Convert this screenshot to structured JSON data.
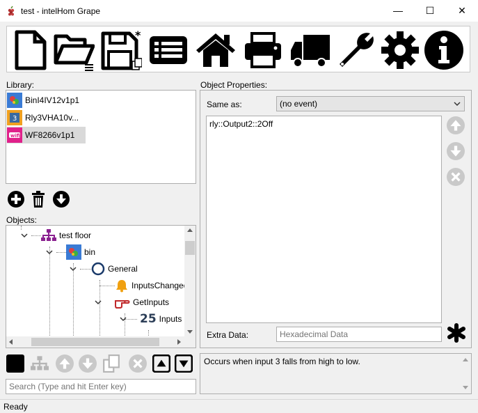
{
  "window": {
    "title": "test - intelHom Grape",
    "minimize": "—",
    "maximize": "☐",
    "close": "✕"
  },
  "toolbar": {
    "icons": [
      "new-file-icon",
      "open-folder-icon",
      "save-icon",
      "list-icon",
      "home-icon",
      "printer-icon",
      "truck-icon",
      "wrench-icon",
      "gear-icon",
      "info-icon"
    ]
  },
  "library": {
    "label": "Library:",
    "items": [
      {
        "name": "BinI4IV12v1p1"
      },
      {
        "name": "Rly3VHA10v..."
      },
      {
        "name": "WF8266v1p1",
        "selected": true
      }
    ]
  },
  "objects": {
    "label": "Objects:",
    "tree": [
      {
        "label": "test floor",
        "level": 0
      },
      {
        "label": "bin",
        "level": 1
      },
      {
        "label": "General",
        "level": 2
      },
      {
        "label": "InputsChanged",
        "level": 3
      },
      {
        "label": "GetInputs",
        "level": 3
      },
      {
        "label": "Inputs",
        "level": 4
      }
    ]
  },
  "properties": {
    "label": "Object Properties:",
    "same_as_label": "Same as:",
    "same_as_value": "(no event)",
    "body": "rly::Output2::2Off",
    "extra_label": "Extra Data:",
    "extra_placeholder": "Hexadecimal Data"
  },
  "description": "Occurs when input 3 falls from high to low.",
  "search": {
    "placeholder": "Search (Type and hit Enter key)"
  },
  "status": "Ready",
  "icon_badges": {
    "inputs_count": "25",
    "wifi_text": "wifi",
    "rly_text": "3"
  }
}
